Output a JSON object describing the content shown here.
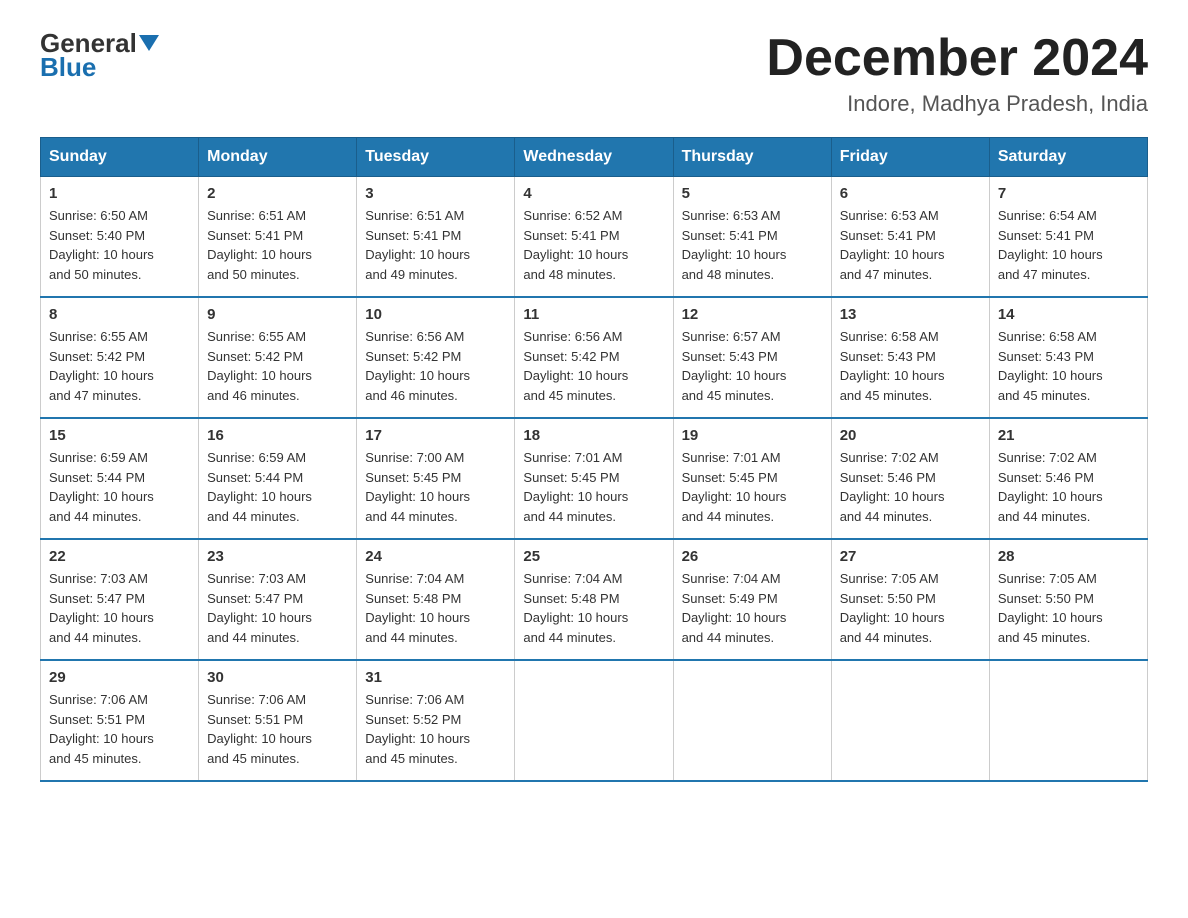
{
  "logo": {
    "general": "General",
    "triangle": "▶",
    "blue": "Blue"
  },
  "title": "December 2024",
  "location": "Indore, Madhya Pradesh, India",
  "headers": [
    "Sunday",
    "Monday",
    "Tuesday",
    "Wednesday",
    "Thursday",
    "Friday",
    "Saturday"
  ],
  "weeks": [
    [
      {
        "day": "1",
        "sunrise": "6:50 AM",
        "sunset": "5:40 PM",
        "daylight": "10 hours and 50 minutes."
      },
      {
        "day": "2",
        "sunrise": "6:51 AM",
        "sunset": "5:41 PM",
        "daylight": "10 hours and 50 minutes."
      },
      {
        "day": "3",
        "sunrise": "6:51 AM",
        "sunset": "5:41 PM",
        "daylight": "10 hours and 49 minutes."
      },
      {
        "day": "4",
        "sunrise": "6:52 AM",
        "sunset": "5:41 PM",
        "daylight": "10 hours and 48 minutes."
      },
      {
        "day": "5",
        "sunrise": "6:53 AM",
        "sunset": "5:41 PM",
        "daylight": "10 hours and 48 minutes."
      },
      {
        "day": "6",
        "sunrise": "6:53 AM",
        "sunset": "5:41 PM",
        "daylight": "10 hours and 47 minutes."
      },
      {
        "day": "7",
        "sunrise": "6:54 AM",
        "sunset": "5:41 PM",
        "daylight": "10 hours and 47 minutes."
      }
    ],
    [
      {
        "day": "8",
        "sunrise": "6:55 AM",
        "sunset": "5:42 PM",
        "daylight": "10 hours and 47 minutes."
      },
      {
        "day": "9",
        "sunrise": "6:55 AM",
        "sunset": "5:42 PM",
        "daylight": "10 hours and 46 minutes."
      },
      {
        "day": "10",
        "sunrise": "6:56 AM",
        "sunset": "5:42 PM",
        "daylight": "10 hours and 46 minutes."
      },
      {
        "day": "11",
        "sunrise": "6:56 AM",
        "sunset": "5:42 PM",
        "daylight": "10 hours and 45 minutes."
      },
      {
        "day": "12",
        "sunrise": "6:57 AM",
        "sunset": "5:43 PM",
        "daylight": "10 hours and 45 minutes."
      },
      {
        "day": "13",
        "sunrise": "6:58 AM",
        "sunset": "5:43 PM",
        "daylight": "10 hours and 45 minutes."
      },
      {
        "day": "14",
        "sunrise": "6:58 AM",
        "sunset": "5:43 PM",
        "daylight": "10 hours and 45 minutes."
      }
    ],
    [
      {
        "day": "15",
        "sunrise": "6:59 AM",
        "sunset": "5:44 PM",
        "daylight": "10 hours and 44 minutes."
      },
      {
        "day": "16",
        "sunrise": "6:59 AM",
        "sunset": "5:44 PM",
        "daylight": "10 hours and 44 minutes."
      },
      {
        "day": "17",
        "sunrise": "7:00 AM",
        "sunset": "5:45 PM",
        "daylight": "10 hours and 44 minutes."
      },
      {
        "day": "18",
        "sunrise": "7:01 AM",
        "sunset": "5:45 PM",
        "daylight": "10 hours and 44 minutes."
      },
      {
        "day": "19",
        "sunrise": "7:01 AM",
        "sunset": "5:45 PM",
        "daylight": "10 hours and 44 minutes."
      },
      {
        "day": "20",
        "sunrise": "7:02 AM",
        "sunset": "5:46 PM",
        "daylight": "10 hours and 44 minutes."
      },
      {
        "day": "21",
        "sunrise": "7:02 AM",
        "sunset": "5:46 PM",
        "daylight": "10 hours and 44 minutes."
      }
    ],
    [
      {
        "day": "22",
        "sunrise": "7:03 AM",
        "sunset": "5:47 PM",
        "daylight": "10 hours and 44 minutes."
      },
      {
        "day": "23",
        "sunrise": "7:03 AM",
        "sunset": "5:47 PM",
        "daylight": "10 hours and 44 minutes."
      },
      {
        "day": "24",
        "sunrise": "7:04 AM",
        "sunset": "5:48 PM",
        "daylight": "10 hours and 44 minutes."
      },
      {
        "day": "25",
        "sunrise": "7:04 AM",
        "sunset": "5:48 PM",
        "daylight": "10 hours and 44 minutes."
      },
      {
        "day": "26",
        "sunrise": "7:04 AM",
        "sunset": "5:49 PM",
        "daylight": "10 hours and 44 minutes."
      },
      {
        "day": "27",
        "sunrise": "7:05 AM",
        "sunset": "5:50 PM",
        "daylight": "10 hours and 44 minutes."
      },
      {
        "day": "28",
        "sunrise": "7:05 AM",
        "sunset": "5:50 PM",
        "daylight": "10 hours and 45 minutes."
      }
    ],
    [
      {
        "day": "29",
        "sunrise": "7:06 AM",
        "sunset": "5:51 PM",
        "daylight": "10 hours and 45 minutes."
      },
      {
        "day": "30",
        "sunrise": "7:06 AM",
        "sunset": "5:51 PM",
        "daylight": "10 hours and 45 minutes."
      },
      {
        "day": "31",
        "sunrise": "7:06 AM",
        "sunset": "5:52 PM",
        "daylight": "10 hours and 45 minutes."
      },
      null,
      null,
      null,
      null
    ]
  ],
  "labels": {
    "sunrise": "Sunrise:",
    "sunset": "Sunset:",
    "daylight": "Daylight:"
  }
}
